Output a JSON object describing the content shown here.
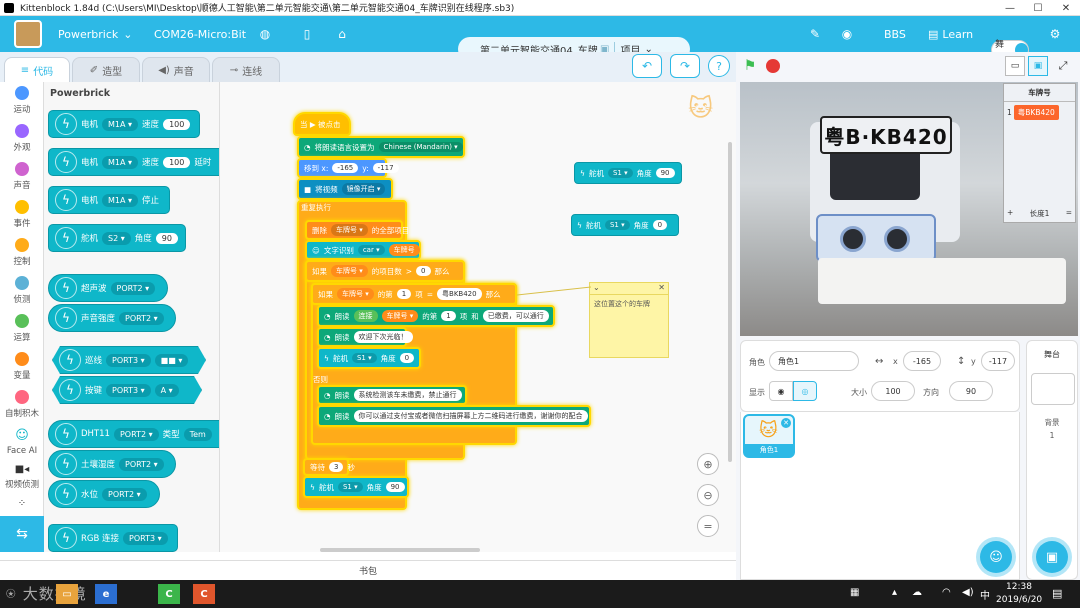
{
  "window": {
    "title": "Kittenblock 1.84d (C:\\Users\\MI\\Desktop\\顺德人工智能\\第二单元智能交通\\第二单元智能交通04_车牌识别在线程序.sb3)",
    "controls": [
      "—",
      "☐",
      "✕"
    ]
  },
  "menu": {
    "device": "Powerbrick",
    "port": "COM26-Micro:Bit",
    "project_name": "第二单元智能交通04_车牌",
    "project_menu": "项目",
    "bbs": "BBS",
    "learn": "Learn",
    "stage_toggle": "舞台"
  },
  "tabs": [
    {
      "label": "代码",
      "icon": "code-icon"
    },
    {
      "label": "造型",
      "icon": "brush-icon"
    },
    {
      "label": "声音",
      "icon": "speaker-icon"
    },
    {
      "label": "连线",
      "icon": "wire-icon"
    }
  ],
  "categories": [
    {
      "label": "运动",
      "color": "#4c97ff"
    },
    {
      "label": "外观",
      "color": "#9966ff"
    },
    {
      "label": "声音",
      "color": "#cf63cf"
    },
    {
      "label": "事件",
      "color": "#ffbf00"
    },
    {
      "label": "控制",
      "color": "#ffab19"
    },
    {
      "label": "侦测",
      "color": "#5cb1d6"
    },
    {
      "label": "运算",
      "color": "#59c059"
    },
    {
      "label": "变量",
      "color": "#ff8c1a"
    },
    {
      "label": "自制积木",
      "color": "#ff6680"
    },
    {
      "label": "Face AI",
      "color": "#0fb7c9"
    },
    {
      "label": "视频侦测",
      "color": "#0fb7c9"
    }
  ],
  "palette": {
    "title": "Powerbrick",
    "blocks": [
      {
        "parts": [
          "电机",
          "M1A ▾",
          "速度",
          "100"
        ]
      },
      {
        "parts": [
          "电机",
          "M1A ▾",
          "速度",
          "100",
          "延时"
        ]
      },
      {
        "parts": [
          "电机",
          "M1A ▾",
          "停止"
        ]
      },
      {
        "parts": [
          "舵机",
          "S2 ▾",
          "角度",
          "90"
        ]
      },
      {
        "parts": [
          "超声波",
          "PORT2 ▾"
        ]
      },
      {
        "parts": [
          "声音强度",
          "PORT2 ▾"
        ]
      },
      {
        "parts": [
          "巡线",
          "PORT3 ▾",
          "■■ ▾"
        ]
      },
      {
        "parts": [
          "按键",
          "PORT3 ▾",
          "A ▾"
        ]
      },
      {
        "parts": [
          "DHT11",
          "PORT2 ▾",
          "类型",
          "Tem"
        ]
      },
      {
        "parts": [
          "土壤湿度",
          "PORT2 ▾"
        ]
      },
      {
        "parts": [
          "水位",
          "PORT2 ▾"
        ]
      },
      {
        "parts": [
          "RGB 连接",
          "PORT3 ▾"
        ]
      }
    ]
  },
  "script": {
    "hat": "当 ▶ 被点击",
    "set_lang": [
      "将朗读语言设置为",
      "Chinese (Mandarin) ▾"
    ],
    "goto": [
      "移到 x:",
      "-165",
      "y:",
      "-117"
    ],
    "video": [
      "将视频",
      "镜像开启 ▾"
    ],
    "forever": "重复执行",
    "delete_all": [
      "删除",
      "车牌号 ▾",
      "的全部项目"
    ],
    "ocr": [
      "文字识别",
      "car ▾",
      "车牌号"
    ],
    "if1": [
      "如果",
      "车牌号 ▾",
      "的项目数",
      ">",
      "0",
      "那么"
    ],
    "if2": [
      "如果",
      "车牌号 ▾",
      "的第",
      "1",
      "项",
      "=",
      "粤BKB420",
      "那么"
    ],
    "speak1": [
      "朗读",
      "连接",
      "车牌号 ▾",
      "的第",
      "1",
      "项",
      "和",
      "已缴费，可以通行"
    ],
    "speak2": [
      "朗读",
      "欢迎下次光临！"
    ],
    "servo1": [
      "舵机",
      "S1 ▾",
      "角度",
      "0"
    ],
    "else": "否则",
    "speak3": [
      "朗读",
      "系统检测该车未缴费，禁止通行"
    ],
    "speak4": [
      "朗读",
      "你可以通过支付宝或者微信扫描屏幕上方二维码进行缴费，谢谢你的配合"
    ],
    "wait": [
      "等待",
      "3",
      "秒"
    ],
    "servo2": [
      "舵机",
      "S1 ▾",
      "角度",
      "90"
    ],
    "loose1": [
      "舵机",
      "S1 ▾",
      "角度",
      "90"
    ],
    "loose2": [
      "舵机",
      "S1 ▾",
      "角度",
      "0"
    ],
    "note": "这位置这个的车牌",
    "note_close": "✕"
  },
  "bookbag": "书包",
  "stage": {
    "plate_text": "粤B·KB420",
    "monitor": {
      "title": "车牌号",
      "index": "1",
      "value": "粤BKB420",
      "plus": "+",
      "length": "长度1",
      "eq": "="
    }
  },
  "sprite_info": {
    "sprite_label": "角色",
    "sprite_name": "角色1",
    "x_label": "x",
    "x": "-165",
    "y_label": "y",
    "y": "-117",
    "show_label": "显示",
    "size_label": "大小",
    "size": "100",
    "dir_label": "方向",
    "direction": "90"
  },
  "sprite_tile": {
    "name": "角色1"
  },
  "stage_col": {
    "title": "舞台",
    "backdrop_label": "背景",
    "backdrop_count": "1"
  },
  "taskbar": {
    "time": "12:38",
    "date": "2019/6/20",
    "ime": "中",
    "watermark": "大数據境"
  }
}
